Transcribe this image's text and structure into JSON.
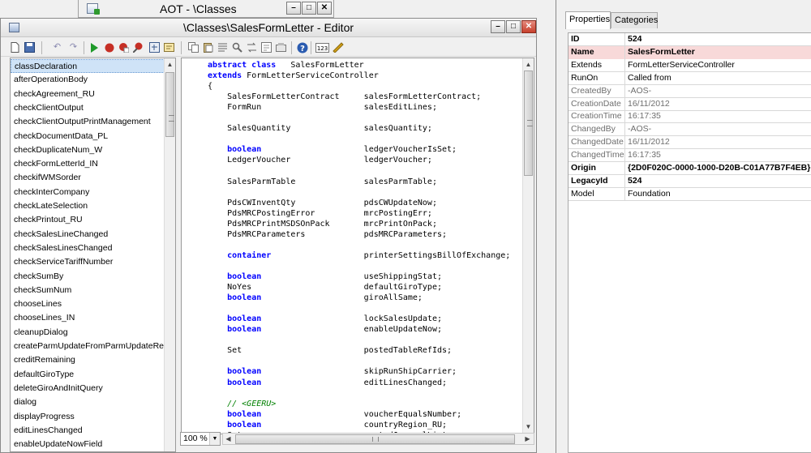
{
  "aot_window": {
    "title": "AOT - \\Classes"
  },
  "editor": {
    "title": "\\Classes\\SalesFormLetter - Editor",
    "zoom": "100 %",
    "methods": [
      "classDeclaration",
      "afterOperationBody",
      "checkAgreement_RU",
      "checkClientOutput",
      "checkClientOutputPrintManagement",
      "checkDocumentData_PL",
      "checkDuplicateNum_W",
      "checkFormLetterId_IN",
      "checkifWMSorder",
      "checkInterCompany",
      "checkLateSelection",
      "checkPrintout_RU",
      "checkSalesLineChanged",
      "checkSalesLinesChanged",
      "checkServiceTariffNumber",
      "checkSumBy",
      "checkSumNum",
      "chooseLines",
      "chooseLines_IN",
      "cleanupDialog",
      "createParmUpdateFromParmUpdateRecord",
      "creditRemaining",
      "defaultGiroType",
      "deleteGiroAndInitQuery",
      "dialog",
      "displayProgress",
      "editLinesChanged",
      "enableUpdateNowField"
    ],
    "selected_method": "classDeclaration",
    "code_lines": [
      {
        "parts": [
          {
            "t": "abstract class",
            "k": 1
          },
          {
            "t": "   SalesFormLetter"
          }
        ]
      },
      {
        "parts": [
          {
            "t": "extends",
            "k": 1
          },
          {
            "t": " FormLetterServiceController"
          }
        ]
      },
      {
        "parts": [
          {
            "t": "{"
          }
        ]
      },
      {
        "parts": [
          {
            "t": "    SalesFormLetterContract     salesFormLetterContract;"
          }
        ]
      },
      {
        "parts": [
          {
            "t": "    FormRun                     salesEditLines;"
          }
        ]
      },
      {
        "parts": []
      },
      {
        "parts": [
          {
            "t": "    SalesQuantity               salesQuantity;"
          }
        ]
      },
      {
        "parts": []
      },
      {
        "parts": [
          {
            "t": "    "
          },
          {
            "t": "boolean",
            "k": 1
          },
          {
            "t": "                     ledgerVoucherIsSet;"
          }
        ]
      },
      {
        "parts": [
          {
            "t": "    LedgerVoucher               ledgerVoucher;"
          }
        ]
      },
      {
        "parts": []
      },
      {
        "parts": [
          {
            "t": "    SalesParmTable              salesParmTable;"
          }
        ]
      },
      {
        "parts": []
      },
      {
        "parts": [
          {
            "t": "    PdsCWInventQty              pdsCWUpdateNow;"
          }
        ]
      },
      {
        "parts": [
          {
            "t": "    PdsMRCPostingError          mrcPostingErr;"
          }
        ]
      },
      {
        "parts": [
          {
            "t": "    PdsMRCPrintMSDSOnPack       mrcPrintOnPack;"
          }
        ]
      },
      {
        "parts": [
          {
            "t": "    PdsMRCParameters            pdsMRCParameters;"
          }
        ]
      },
      {
        "parts": []
      },
      {
        "parts": [
          {
            "t": "    "
          },
          {
            "t": "container",
            "k": 1
          },
          {
            "t": "                   printerSettingsBillOfExchange;"
          }
        ]
      },
      {
        "parts": []
      },
      {
        "parts": [
          {
            "t": "    "
          },
          {
            "t": "boolean",
            "k": 1
          },
          {
            "t": "                     useShippingStat;"
          }
        ]
      },
      {
        "parts": [
          {
            "t": "    NoYes                       defaultGiroType;"
          }
        ]
      },
      {
        "parts": [
          {
            "t": "    "
          },
          {
            "t": "boolean",
            "k": 1
          },
          {
            "t": "                     giroAllSame;"
          }
        ]
      },
      {
        "parts": []
      },
      {
        "parts": [
          {
            "t": "    "
          },
          {
            "t": "boolean",
            "k": 1
          },
          {
            "t": "                     lockSalesUpdate;"
          }
        ]
      },
      {
        "parts": [
          {
            "t": "    "
          },
          {
            "t": "boolean",
            "k": 1
          },
          {
            "t": "                     enableUpdateNow;"
          }
        ]
      },
      {
        "parts": []
      },
      {
        "parts": [
          {
            "t": "    Set                         postedTableRefIds;"
          }
        ]
      },
      {
        "parts": []
      },
      {
        "parts": [
          {
            "t": "    "
          },
          {
            "t": "boolean",
            "k": 1
          },
          {
            "t": "                     skipRunShipCarrier;"
          }
        ]
      },
      {
        "parts": [
          {
            "t": "    "
          },
          {
            "t": "boolean",
            "k": 1
          },
          {
            "t": "                     editLinesChanged;"
          }
        ]
      },
      {
        "parts": []
      },
      {
        "parts": [
          {
            "t": "    "
          },
          {
            "t": "// <GEERU>",
            "c": 1
          }
        ]
      },
      {
        "parts": [
          {
            "t": "    "
          },
          {
            "t": "boolean",
            "k": 1
          },
          {
            "t": "                     voucherEqualsNumber;"
          }
        ]
      },
      {
        "parts": [
          {
            "t": "    "
          },
          {
            "t": "boolean",
            "k": 1
          },
          {
            "t": "                     countryRegion_RU;"
          }
        ]
      },
      {
        "parts": [
          {
            "t": "    Set                         postedJournalList;"
          }
        ]
      }
    ]
  },
  "properties": {
    "tabs": [
      "Properties",
      "Categories"
    ],
    "active_tab": "Properties",
    "rows": [
      {
        "key": "ID",
        "value": "524",
        "style": "b"
      },
      {
        "key": "Name",
        "value": "SalesFormLetter",
        "style": "b hl"
      },
      {
        "key": "Extends",
        "value": "FormLetterServiceController",
        "style": ""
      },
      {
        "key": "RunOn",
        "value": "Called from",
        "style": ""
      },
      {
        "key": "CreatedBy",
        "value": "-AOS-",
        "style": "g"
      },
      {
        "key": "CreationDate",
        "value": "16/11/2012",
        "style": "g"
      },
      {
        "key": "CreationTime",
        "value": "16:17:35",
        "style": "g"
      },
      {
        "key": "ChangedBy",
        "value": "-AOS-",
        "style": "g"
      },
      {
        "key": "ChangedDate",
        "value": "16/11/2012",
        "style": "g"
      },
      {
        "key": "ChangedTime",
        "value": "16:17:35",
        "style": "g"
      },
      {
        "key": "Origin",
        "value": "{2D0F020C-0000-1000-D20B-C01A77B7F4EB}",
        "style": "b"
      },
      {
        "key": "LegacyId",
        "value": "524",
        "style": "b"
      },
      {
        "key": "Model",
        "value": "Foundation",
        "style": ""
      }
    ]
  },
  "toolbar_icons": [
    "new-icon",
    "save-icon",
    "undo-icon",
    "redo-icon",
    "run-icon",
    "breakpoint-icon",
    "remove-breakpoint-icon",
    "toggle-breakpoint-icon",
    "compile-icon",
    "lookup-icon",
    "copy-icon",
    "paste-icon",
    "list-icon",
    "find-icon",
    "replace-icon",
    "script-icon",
    "help-icon",
    "line-number-icon",
    "tools-icon"
  ]
}
